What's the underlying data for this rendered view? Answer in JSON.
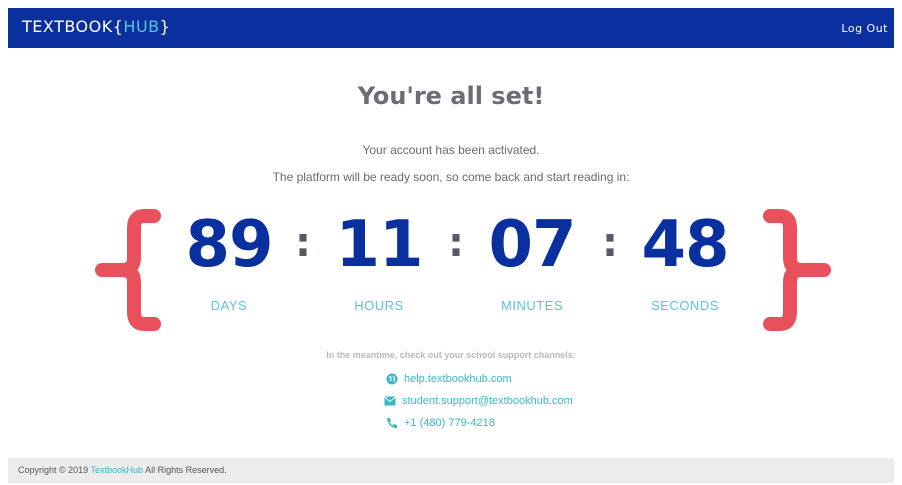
{
  "header": {
    "logo_text": "TEXTBOOK",
    "logo_hub": "HUB",
    "logo_open": "{",
    "logo_close": "}",
    "logout_label": "Log Out"
  },
  "main": {
    "title": "You're all set!",
    "activated_text": "Your account has been activated.",
    "ready_text": "The platform will be ready soon, so come back and start reading in:"
  },
  "countdown": {
    "days": {
      "value": "89",
      "label": "DAYS"
    },
    "hours": {
      "value": "11",
      "label": "HOURS"
    },
    "minutes": {
      "value": "07",
      "label": "MINUTES"
    },
    "seconds": {
      "value": "48",
      "label": "SECONDS"
    },
    "separator": ":"
  },
  "support": {
    "heading": "In the meantime, check out your school support channels:",
    "website": "help.textbookhub.com",
    "email": "student.support@textbookhub.com",
    "phone": "+1 (480) 779-4218"
  },
  "footer": {
    "copyright_prefix": "Copyright © 2019",
    "brand": "TextbookHub",
    "copyright_suffix": "All Rights Reserved."
  },
  "colors": {
    "navy": "#0a2f9e",
    "teal": "#5bc4d8",
    "brace_red": "#e8505b"
  }
}
